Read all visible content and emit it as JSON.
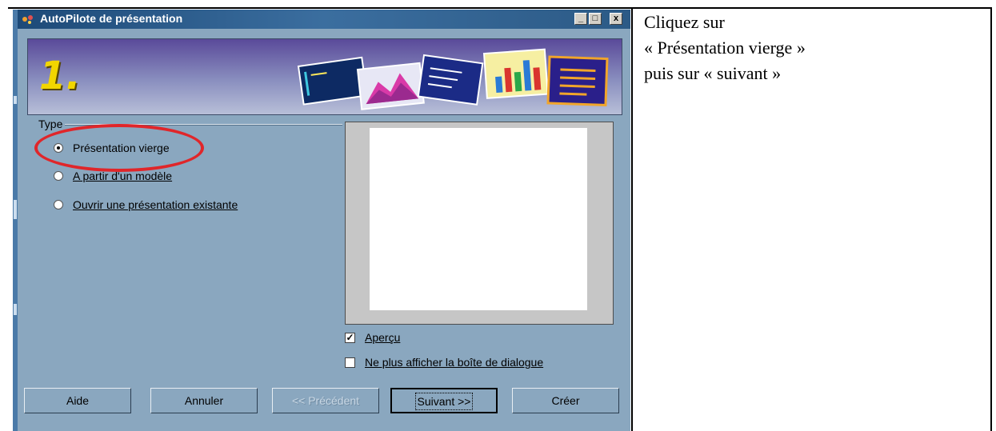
{
  "dialog": {
    "title": "AutoPilote de présentation",
    "step_number": "1.",
    "window_buttons": {
      "minimize": "_",
      "maximize": "□",
      "close": "x"
    },
    "type_group_label": "Type",
    "radios": [
      {
        "label": "Présentation vierge",
        "selected": true
      },
      {
        "label": "A partir d'un modèle",
        "selected": false
      },
      {
        "label": "Ouvrir une présentation existante",
        "selected": false
      }
    ],
    "preview_checkbox": {
      "label": "Aperçu",
      "checked": true,
      "mark": "✓"
    },
    "hide_dialog_checkbox": {
      "label": "Ne plus afficher la boîte de dialogue",
      "checked": false
    },
    "buttons": {
      "help": "Aide",
      "cancel": "Annuler",
      "previous": "<< Précédent",
      "next": "Suivant >>",
      "create": "Créer"
    }
  },
  "instruction": {
    "line1": "Cliquez sur",
    "line2": "« Présentation vierge »",
    "line3": "puis sur « suivant »"
  },
  "colors": {
    "dialog_bg": "#8aa7bf",
    "titlebar": "#1d4a78",
    "highlight": "#e0262a",
    "step_number": "#f2d600"
  }
}
